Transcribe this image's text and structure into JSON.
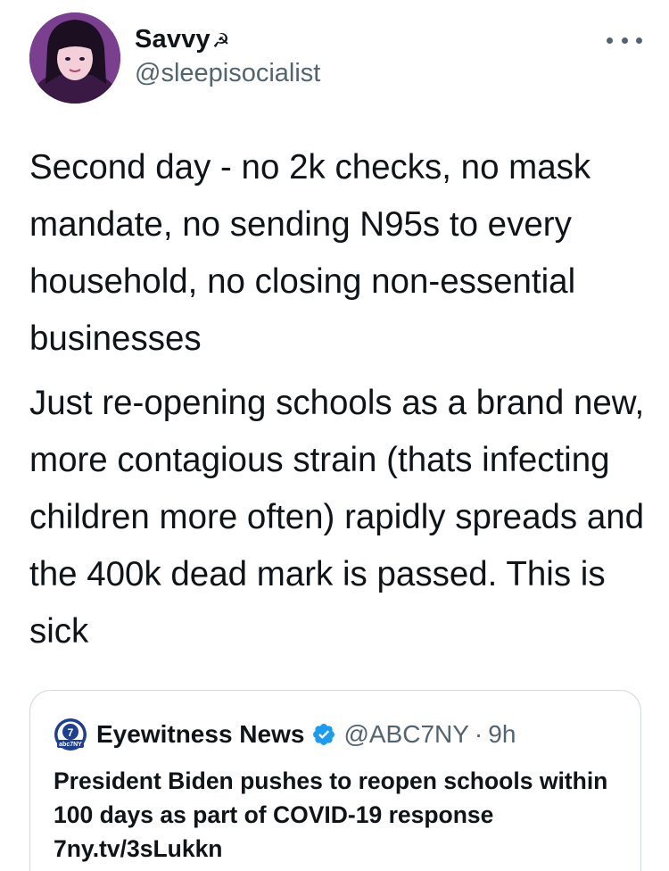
{
  "author": {
    "display_name": "Savvy",
    "name_emoji": "☭",
    "handle": "@sleepisocialist",
    "avatar_icon": "user-avatar"
  },
  "more_icon": "more-horizontal-icon",
  "tweet": {
    "paragraph_1": "Second day - no 2k checks, no mask mandate, no sending N95s to every household, no closing non-essential businesses",
    "paragraph_2": "Just re-opening schools as a brand new, more contagious strain (thats infecting children more often) rapidly spreads and the 400k dead mark is passed. This is sick"
  },
  "quoted_tweet": {
    "name": "Eyewitness News",
    "handle": "@ABC7NY",
    "separator": "·",
    "time": "9h",
    "logo_text": "abc7NY",
    "verified_icon": "verified-badge-icon",
    "text": "President Biden pushes to reopen schools within 100 days as part of COVID-19 response 7ny.tv/3sLukkn"
  },
  "colors": {
    "text_primary": "#0f1419",
    "text_secondary": "#536471",
    "verified": "#1d9bf0",
    "border": "#cfd9de"
  }
}
